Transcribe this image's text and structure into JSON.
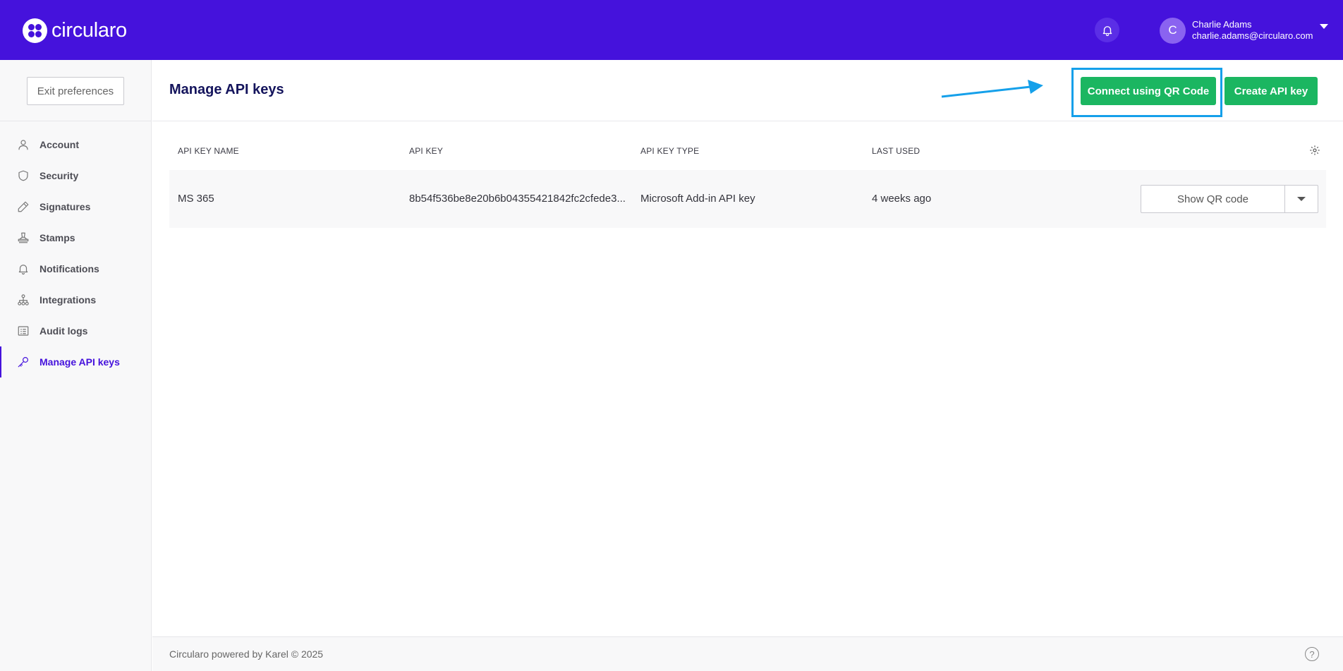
{
  "header": {
    "logo_text": "circularo",
    "user": {
      "initial": "C",
      "name": "Charlie Adams",
      "email": "charlie.adams@circularo.com"
    }
  },
  "sidebar": {
    "exit_label": "Exit preferences",
    "items": [
      {
        "label": "Account",
        "icon": "user-icon"
      },
      {
        "label": "Security",
        "icon": "shield-icon"
      },
      {
        "label": "Signatures",
        "icon": "pen-icon"
      },
      {
        "label": "Stamps",
        "icon": "stamp-icon"
      },
      {
        "label": "Notifications",
        "icon": "bell-icon"
      },
      {
        "label": "Integrations",
        "icon": "sitemap-icon"
      },
      {
        "label": "Audit logs",
        "icon": "list-icon"
      },
      {
        "label": "Manage API keys",
        "icon": "key-icon",
        "active": true
      }
    ]
  },
  "main": {
    "title": "Manage API keys",
    "qr_button": "Connect using QR Code",
    "create_button": "Create API key",
    "table": {
      "columns": [
        "API KEY NAME",
        "API KEY",
        "API KEY TYPE",
        "LAST USED"
      ],
      "rows": [
        {
          "name": "MS 365",
          "key": "8b54f536be8e20b6b04355421842fc2cfede3...",
          "type": "Microsoft Add-in API key",
          "last_used": "4 weeks ago",
          "action": "Show QR code"
        }
      ]
    }
  },
  "footer": {
    "text": "Circularo powered by Karel © 2025",
    "help": "?"
  },
  "colors": {
    "brand": "#4512dc",
    "primary_action": "#1bb661",
    "annotation": "#15a0ea"
  }
}
